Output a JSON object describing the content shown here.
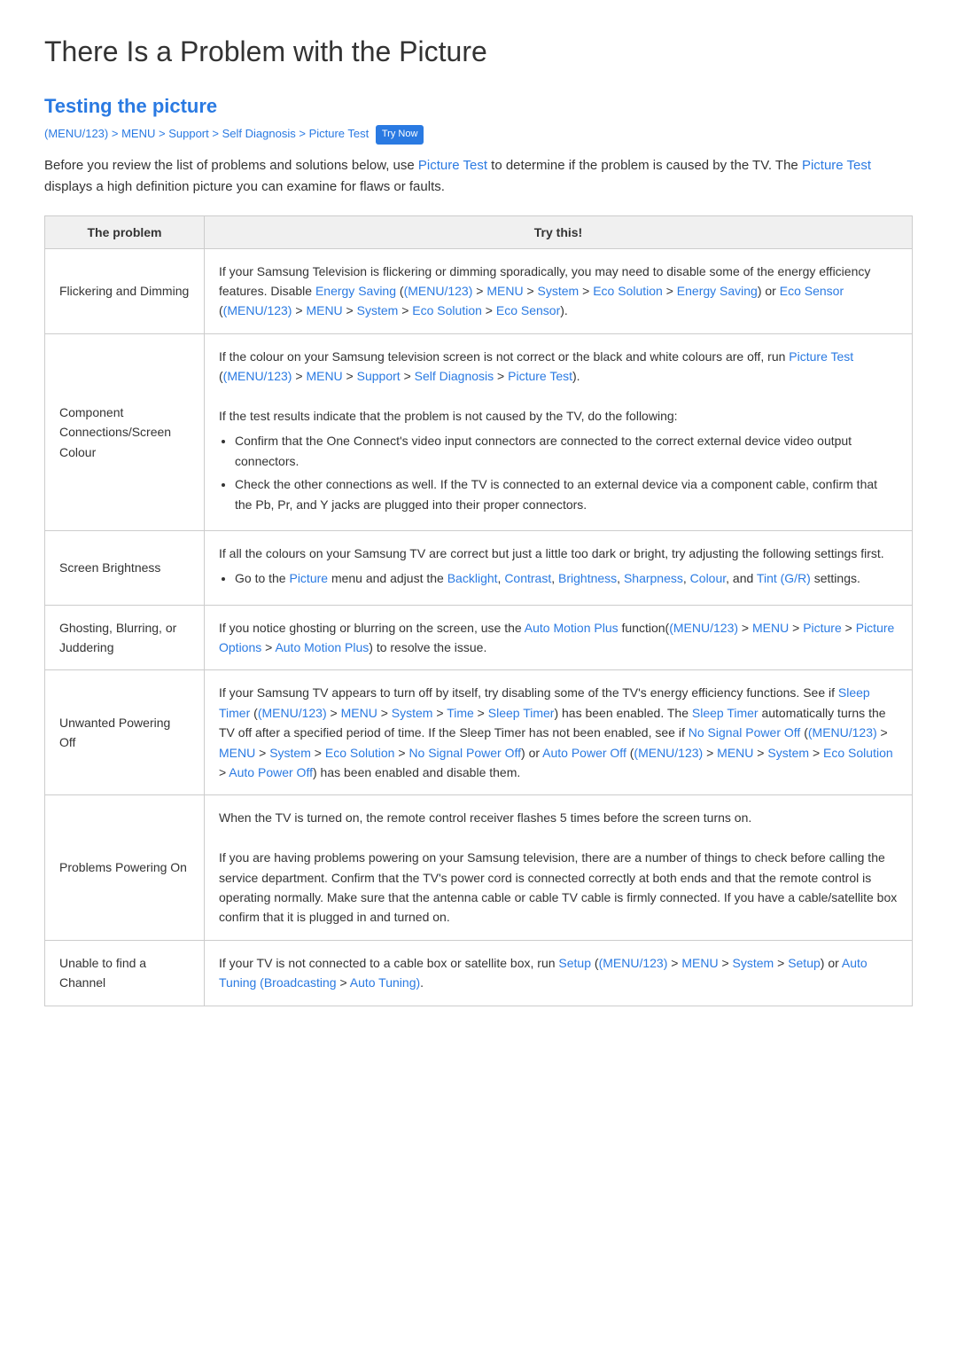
{
  "page": {
    "title": "There Is a Problem with the Picture",
    "section_title": "Testing the picture",
    "breadcrumb": {
      "parts": [
        {
          "text": "(MENU/123)",
          "colored": true
        },
        {
          "text": " > ",
          "colored": false
        },
        {
          "text": "MENU",
          "colored": true
        },
        {
          "text": " > ",
          "colored": false
        },
        {
          "text": "Support",
          "colored": true
        },
        {
          "text": " > ",
          "colored": false
        },
        {
          "text": "Self Diagnosis",
          "colored": true
        },
        {
          "text": " > ",
          "colored": false
        },
        {
          "text": "Picture Test",
          "colored": true
        }
      ],
      "badge": "Try Now"
    },
    "intro": "Before you review the list of problems and solutions below, use Picture Test to determine if the problem is caused by the TV. The Picture Test displays a high definition picture you can examine for flaws or faults.",
    "table": {
      "col1": "The problem",
      "col2": "Try this!",
      "rows": [
        {
          "problem": "Flickering and Dimming",
          "solution_html": "flickering_dimming"
        },
        {
          "problem": "Component Connections/Screen Colour",
          "solution_html": "component_colour"
        },
        {
          "problem": "Screen Brightness",
          "solution_html": "screen_brightness"
        },
        {
          "problem": "Ghosting, Blurring, or Juddering",
          "solution_html": "ghosting"
        },
        {
          "problem": "Unwanted Powering Off",
          "solution_html": "unwanted_off"
        },
        {
          "problem": "Problems Powering On",
          "solution_html": "powering_on"
        },
        {
          "problem": "Unable to find a Channel",
          "solution_html": "no_channel"
        }
      ]
    }
  }
}
